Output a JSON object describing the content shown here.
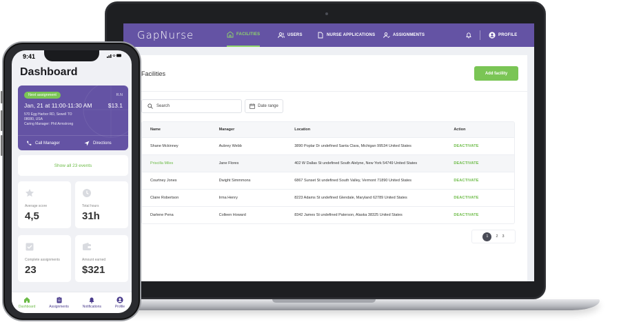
{
  "laptop": {
    "brand": "GapNurse",
    "nav": [
      {
        "label": "FACILITIES",
        "icon": "building-icon",
        "active": true
      },
      {
        "label": "USERS",
        "icon": "users-icon",
        "active": false
      },
      {
        "label": "NURSE APPLICATIONS",
        "icon": "document-icon",
        "active": false
      },
      {
        "label": "ASSIGNMENTS",
        "icon": "user-check-icon",
        "active": false
      }
    ],
    "profile_label": "PROFILE",
    "page_title": "Facilities",
    "add_button": "Add facility",
    "search_placeholder": "Search",
    "date_range_label": "Date range",
    "table": {
      "headers": [
        "Name",
        "Manager",
        "Location",
        "Action"
      ],
      "rows": [
        {
          "name": "Shane Mckinney",
          "manager": "Aubrey Webb",
          "location": "3890 Poplar Dr undefined Santa Clara, Michigan 99534 United States",
          "action": "DEACTIVATE",
          "highlight": false
        },
        {
          "name": "Priscilla Miles",
          "manager": "Jane Flores",
          "location": "402 W Dallas St undefined South Alelyne, New York 54749 United States",
          "action": "DEACTIVATE",
          "highlight": true
        },
        {
          "name": "Courtney Jones",
          "manager": "Dwight Simmmons",
          "location": "6867 Sunset St undefined South Valley, Vermont 71890 United States",
          "action": "DEACTIVATE",
          "highlight": false
        },
        {
          "name": "Claire Robertson",
          "manager": "Irma Henry",
          "location": "8223 Adams St undefined Glendale, Maryland 62789 United States",
          "action": "DEACTIVATE",
          "highlight": false
        },
        {
          "name": "Darlene Pena",
          "manager": "Colleen Howard",
          "location": "8342 James St undefined Paterson, Alaska 38325 United States",
          "action": "DEACTIVATE",
          "highlight": false
        }
      ]
    },
    "pagination": {
      "pages": [
        "1",
        "2",
        "3"
      ],
      "current": "1"
    }
  },
  "phone": {
    "status_time": "9:41",
    "title": "Dashboard",
    "next_assignment": {
      "badge": "Next assignment",
      "role": "R.N",
      "time": "Jan, 21 at 11:00-11:30 AM",
      "pay": "$13.1",
      "address_line1": "570 Egg Harbor RD, Sewell TO",
      "address_line2": "08080, USA",
      "manager": "Caring Manager: Phil Armstrong",
      "call_label": "Call Manager",
      "directions_label": "Directions"
    },
    "show_all": "Show all 23 events",
    "stats": [
      {
        "label": "Average score",
        "value": "4,5",
        "icon": "star-icon"
      },
      {
        "label": "Total hours",
        "value": "31h",
        "icon": "clock-icon"
      },
      {
        "label": "Complete assignments",
        "value": "23",
        "icon": "checklist-icon"
      },
      {
        "label": "Amount earned",
        "value": "$321",
        "icon": "wallet-icon"
      }
    ],
    "tabs": [
      {
        "label": "Dashboard",
        "icon": "home-icon",
        "active": true
      },
      {
        "label": "Assignments",
        "icon": "clipboard-icon",
        "active": false
      },
      {
        "label": "Notifications",
        "icon": "bell-icon",
        "active": false
      },
      {
        "label": "Profile",
        "icon": "person-icon",
        "active": false
      }
    ]
  },
  "colors": {
    "brand_purple": "#6453a4",
    "accent_green": "#7ac555",
    "link_green": "#6cbb47"
  }
}
